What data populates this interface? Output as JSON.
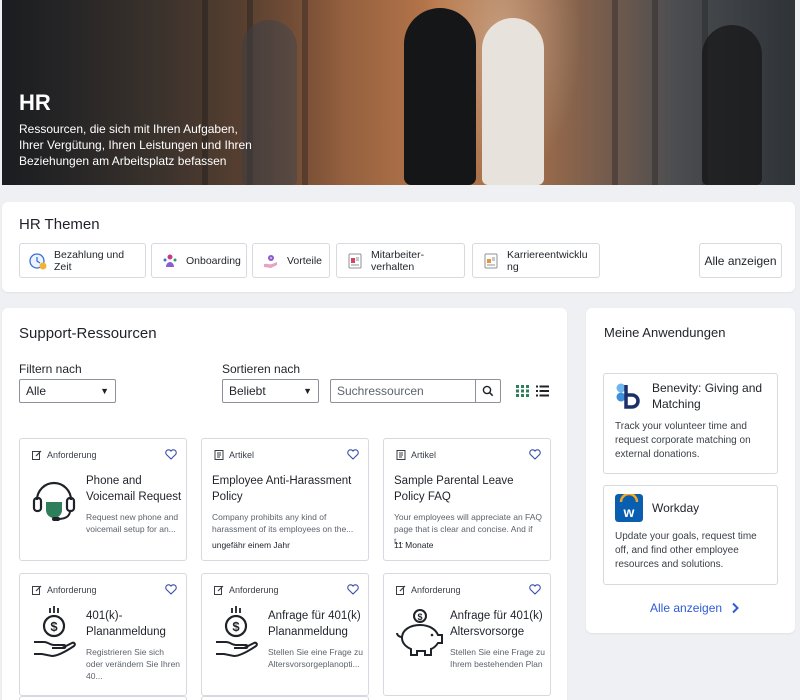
{
  "hero": {
    "title": "HR",
    "subtitle": "Ressourcen, die sich mit Ihren Aufgaben, Ihrer Vergütung, Ihren Leistungen und Ihren Beziehungen am Arbeitsplatz befassen"
  },
  "themen": {
    "heading": "HR Themen",
    "chips": [
      {
        "label": "Bezahlung und Zeit",
        "icon": "clock-money-icon"
      },
      {
        "label": "Onboarding",
        "icon": "people-icon"
      },
      {
        "label": "Vorteile",
        "icon": "benefits-icon"
      },
      {
        "label": "Mitarbeiter-verhalten",
        "icon": "document-icon"
      },
      {
        "label": "Karriereentwicklung",
        "icon": "document-icon"
      }
    ],
    "show_all": "Alle anzeigen"
  },
  "support": {
    "heading": "Support-Ressourcen",
    "filter_label": "Filtern nach",
    "filter_value": "Alle",
    "sort_label": "Sortieren nach",
    "sort_value": "Beliebt",
    "search_placeholder": "Suchressourcen",
    "cards": [
      {
        "type": "Anforderung",
        "title": "Phone and Voicemail Request",
        "desc": "Request new phone and voicemail setup for an...",
        "icon": "headset-icon"
      },
      {
        "type": "Artikel",
        "title": "Employee Anti-Harassment Policy",
        "desc": "Company prohibits any kind of harassment of its employees on the...",
        "meta": "ungefähr einem Jahr"
      },
      {
        "type": "Artikel",
        "title": "Sample Parental Leave Policy FAQ",
        "desc": "Your employees will appreciate an FAQ page that is clear and concise. And if t...",
        "meta": "11 Monate"
      },
      {
        "type": "Anforderung",
        "title": "401(k)-Plananmeldung",
        "desc": "Registrieren Sie sich oder verändern Sie Ihren 40...",
        "icon": "money-hand-icon"
      },
      {
        "type": "Anforderung",
        "title": "Anfrage für 401(k) Plananmeldung",
        "desc": "Stellen Sie eine Frage zu Altersvorsorgeplanopti...",
        "icon": "money-hand-icon"
      },
      {
        "type": "Anforderung",
        "title": "Anfrage für 401(k) Altersvorsorge",
        "desc": "Stellen Sie eine Frage zu Ihrem bestehenden Plan",
        "icon": "piggy-bank-icon"
      }
    ]
  },
  "apps": {
    "heading": "Meine Anwendungen",
    "items": [
      {
        "name": "Benevity: Giving and Matching",
        "desc": "Track your volunteer time and request corporate matching on external donations.",
        "color": "#1f5fbf"
      },
      {
        "name": "Workday",
        "desc": "Update your goals, request time off, and find other employee resources and solutions.",
        "color": "#0a5eb0"
      }
    ],
    "show_all": "Alle anzeigen"
  },
  "colors": {
    "accent": "#2f5bd3",
    "heart": "#3a4ea8",
    "icon_green": "#2e7d5b"
  }
}
